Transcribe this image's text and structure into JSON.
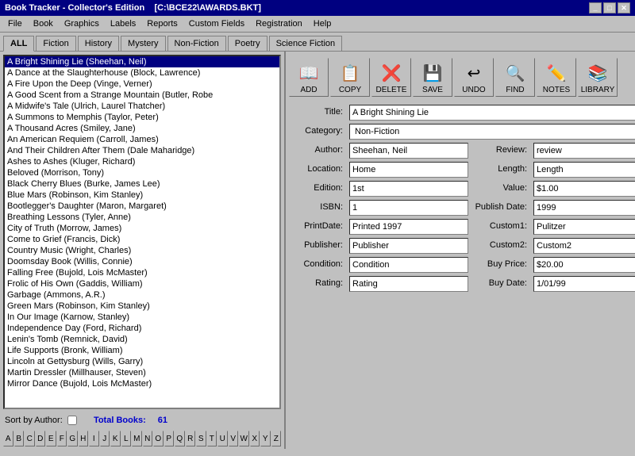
{
  "window": {
    "title": "Book Tracker - Collector's Edition",
    "path": "[C:\\BCE22\\AWARDS.BKT]",
    "min_btn": "_",
    "max_btn": "□",
    "close_btn": "✕"
  },
  "menu": {
    "items": [
      "File",
      "Book",
      "Graphics",
      "Labels",
      "Reports",
      "Custom Fields",
      "Registration",
      "Help"
    ]
  },
  "tabs": {
    "items": [
      "ALL",
      "Fiction",
      "History",
      "Mystery",
      "Non-Fiction",
      "Poetry",
      "Science Fiction"
    ],
    "active": 0
  },
  "toolbar": {
    "buttons": [
      {
        "id": "add",
        "label": "ADD",
        "icon": "📖"
      },
      {
        "id": "copy",
        "label": "COPY",
        "icon": "📋"
      },
      {
        "id": "delete",
        "label": "DELETE",
        "icon": "❌"
      },
      {
        "id": "save",
        "label": "SAVE",
        "icon": "💾"
      },
      {
        "id": "undo",
        "label": "UNDO",
        "icon": "↩"
      },
      {
        "id": "find",
        "label": "FIND",
        "icon": "🔍"
      },
      {
        "id": "notes",
        "label": "NOTES",
        "icon": "✏️"
      },
      {
        "id": "library",
        "label": "LIBRARY",
        "icon": "📚"
      }
    ]
  },
  "booklist": {
    "items": [
      "A Bright Shining Lie (Sheehan, Neil)",
      "A Dance at the Slaughterhouse (Block, Lawrence)",
      "A Fire Upon the Deep (Vinge, Verner)",
      "A Good Scent from a Strange Mountain (Butler, Robe",
      "A Midwife's Tale (Ulrich, Laurel Thatcher)",
      "A Summons to Memphis (Taylor, Peter)",
      "A Thousand Acres (Smiley, Jane)",
      "An American Requiem (Carroll, James)",
      "And Their Children After Them (Dale Maharidge)",
      "Ashes to Ashes (Kluger, Richard)",
      "Beloved (Morrison, Tony)",
      "Black Cherry Blues (Burke, James Lee)",
      "Blue Mars (Robinson, Kim Stanley)",
      "Bootlegger's Daughter (Maron, Margaret)",
      "Breathing Lessons (Tyler, Anne)",
      "City of Truth (Morrow, James)",
      "Come to Grief (Francis, Dick)",
      "Country Music (Wright, Charles)",
      "Doomsday Book (Willis, Connie)",
      "Falling Free (Bujold, Lois McMaster)",
      "Frolic of His Own (Gaddis, William)",
      "Garbage (Ammons, A.R.)",
      "Green Mars (Robinson, Kim Stanley)",
      "In Our Image (Karnow, Stanley)",
      "Independence Day (Ford, Richard)",
      "Lenin's Tomb (Remnick, David)",
      "Life Supports (Bronk, William)",
      "Lincoln at Gettysburg (Wills, Garry)",
      "Martin Dressler (Millhauser, Steven)",
      "Mirror Dance (Bujold, Lois McMaster)"
    ],
    "selected_index": 0
  },
  "footer": {
    "sort_label": "Sort by Author:",
    "total_label": "Total Books:",
    "total_count": "61"
  },
  "alpha": {
    "letters": [
      "A",
      "B",
      "C",
      "D",
      "E",
      "F",
      "G",
      "H",
      "I",
      "J",
      "K",
      "L",
      "M",
      "N",
      "O",
      "P",
      "Q",
      "R",
      "S",
      "T",
      "U",
      "V",
      "W",
      "X",
      "Y",
      "Z"
    ]
  },
  "form": {
    "title_label": "Title:",
    "title_value": "A Bright Shining Lie",
    "category_label": "Category:",
    "category_value": "Non-Fiction",
    "category_options": [
      "All",
      "Fiction",
      "History",
      "Mystery",
      "Non-Fiction",
      "Poetry",
      "Science Fiction"
    ],
    "author_label": "Author:",
    "author_value": "Sheehan, Neil",
    "review_label": "Review:",
    "review_value": "review",
    "location_label": "Location:",
    "location_value": "Home",
    "length_label": "Length:",
    "length_value": "Length",
    "edition_label": "Edition:",
    "edition_value": "1st",
    "value_label": "Value:",
    "value_value": "$1.00",
    "isbn_label": "ISBN:",
    "isbn_value": "1",
    "publish_date_label": "Publish Date:",
    "publish_date_value": "1999",
    "print_date_label": "PrintDate:",
    "print_date_value": "Printed 1997",
    "custom1_label": "Custom1:",
    "custom1_value": "Pulitzer",
    "publisher_label": "Publisher:",
    "publisher_value": "Publisher",
    "custom2_label": "Custom2:",
    "custom2_value": "Custom2",
    "condition_label": "Condition:",
    "condition_value": "Condition",
    "buy_price_label": "Buy Price:",
    "buy_price_value": "$20.00",
    "rating_label": "Rating:",
    "rating_value": "Rating",
    "buy_date_label": "Buy Date:",
    "buy_date_value": "1/01/99"
  }
}
